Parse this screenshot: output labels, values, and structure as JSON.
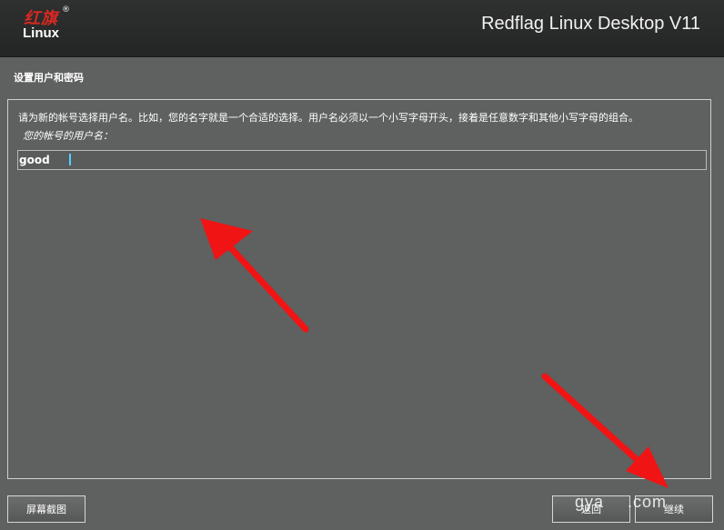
{
  "header": {
    "logo_cn": "红旗",
    "logo_mark": "®",
    "logo_text": "Linux",
    "product_title": "Redflag Linux Desktop V11"
  },
  "page": {
    "title": "设置用户和密码",
    "instruction": "请为新的帐号选择用户名。比如，您的名字就是一个合适的选择。用户名必须以一个小写字母开头，接着是任意数字和其他小写字母的组合。",
    "field_label": "您的帐号的用户名：",
    "username_value": "good"
  },
  "buttons": {
    "screenshot": "屏幕截图",
    "back": "返回",
    "continue": "继续"
  },
  "watermark": {
    "left": "gya",
    "right": ".com"
  },
  "colors": {
    "arrow": "#f01414",
    "logo_red": "#d62a22",
    "caret": "#4dd2ff",
    "header_bg": "#2a2b2b",
    "panel_bg": "#5f6060"
  },
  "icons": {
    "arrow_1": "red-arrow-icon",
    "arrow_2": "red-arrow-icon"
  }
}
